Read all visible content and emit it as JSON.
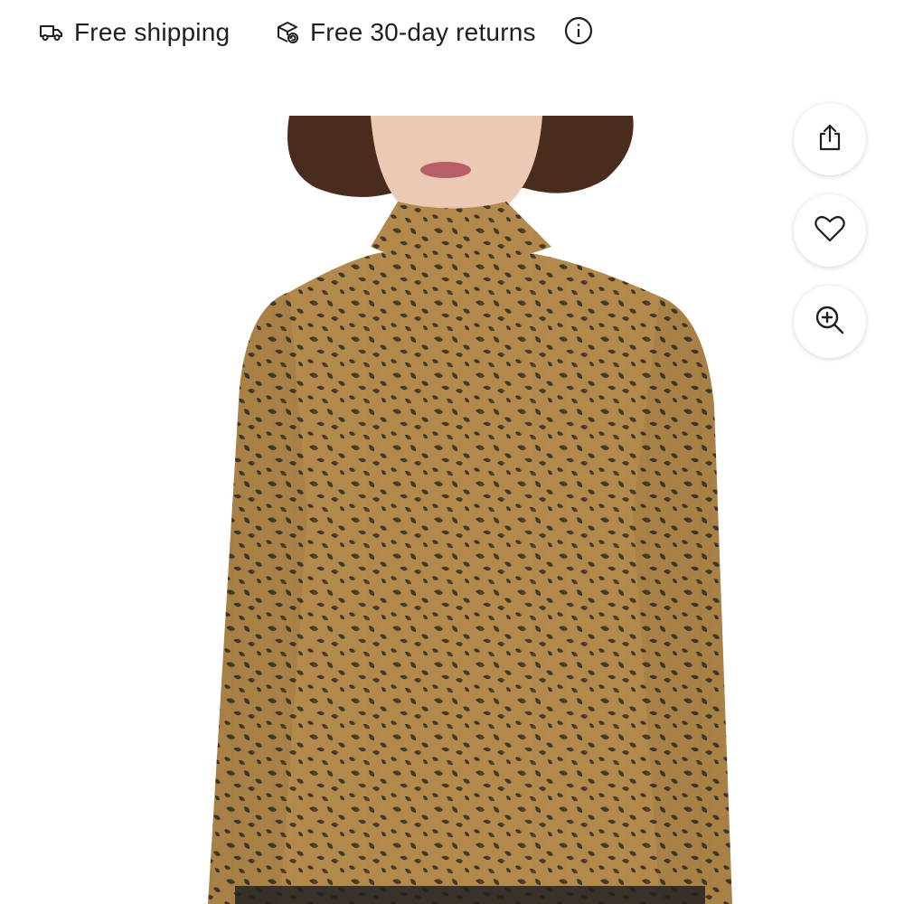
{
  "promo_bar": {
    "shipping_label": "Free shipping",
    "shipping_icon": "truck-icon",
    "returns_label": "Free 30-day returns",
    "returns_icon": "return-box-icon",
    "info_icon": "info-icon"
  },
  "product_image": {
    "icon_hint": "product-photo",
    "colors": {
      "fabric": "#b48a4c",
      "spots": "#3f3a2a",
      "hair": "#4a2c1c",
      "skin": "#e8c4b0"
    }
  },
  "actions": {
    "share_icon": "share-icon",
    "favorite_icon": "heart-icon",
    "zoom_icon": "zoom-in-icon"
  }
}
